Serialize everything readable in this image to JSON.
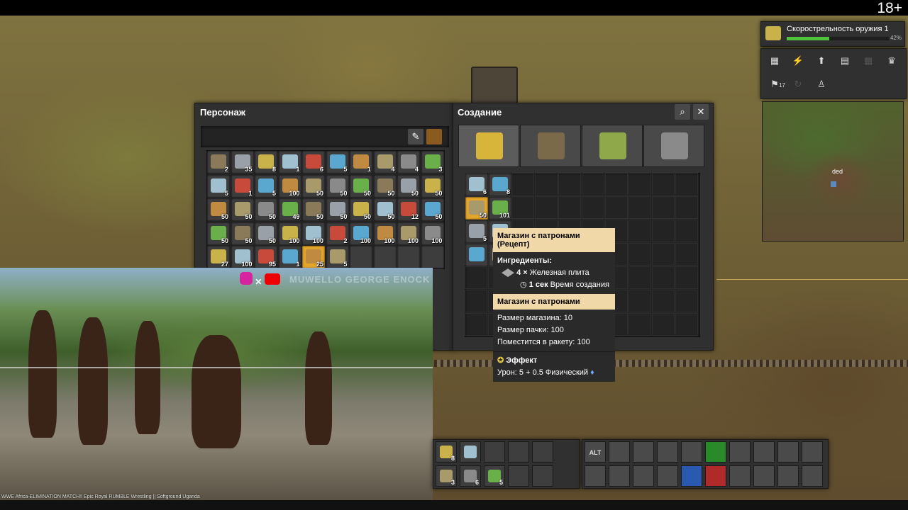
{
  "age_rating": "18+",
  "character_panel": {
    "title": "Персонаж",
    "inventory": [
      [
        "2",
        "35",
        "8",
        "1",
        "6",
        "5",
        "1",
        "4",
        "4",
        "3"
      ],
      [
        "5",
        "1",
        "5",
        "100",
        "50",
        "50",
        "50",
        "50",
        "50",
        "50"
      ],
      [
        "50",
        "50",
        "50",
        "49",
        "50",
        "50",
        "50",
        "50",
        "12",
        "50"
      ],
      [
        "50",
        "50",
        "50",
        "100",
        "100",
        "2",
        "100",
        "100",
        "100",
        "100"
      ],
      [
        "27",
        "100",
        "95",
        "1",
        "25",
        "5",
        "",
        "",
        "",
        ""
      ]
    ]
  },
  "crafting_panel": {
    "title": "Создание",
    "grid": [
      {
        "count": "6"
      },
      {
        "count": "8"
      },
      {
        "count": "50"
      },
      {
        "count": "101"
      },
      {
        "count": "5"
      },
      {
        "count": ""
      },
      {
        "count": ""
      },
      {
        "count": "5"
      }
    ]
  },
  "tooltip": {
    "title": "Магазин с патронами (Рецепт)",
    "ingredients_label": "Ингредиенты:",
    "ingredient_count": "4 ×",
    "ingredient_name": "Железная плита",
    "time_value": "1 сек",
    "time_label": "Время создания",
    "item_title": "Магазин с патронами",
    "magazine_size": "Размер магазина: 10",
    "stack_size": "Размер пачки: 100",
    "rocket_capacity": "Поместится в ракету: 100",
    "effect_label": "Эффект",
    "damage": "Урон: 5 + 0.5 Физический"
  },
  "research": {
    "name": "Скорострельность оружия 1",
    "progress_text": "42%",
    "progress": 0.42
  },
  "research_badge": "17",
  "minimap": {
    "label": "ded"
  },
  "video": {
    "caption": "WWE Africa-ELIMINATION MATCH!! Epic Royal RUMBLE Wrestling || Softground Uganda",
    "watermark": "MUWELLO GEORGE ENOCK"
  },
  "toolbar": {
    "slots": [
      "8",
      "",
      "",
      "",
      "",
      "3",
      "6",
      "5",
      "",
      ""
    ],
    "shortcut_alt": "ALT"
  },
  "colors": {
    "panel": "#313031",
    "highlight": "#e3a42a",
    "tooltip_header": "#f0d8a8",
    "progress": "#4fc33b"
  }
}
